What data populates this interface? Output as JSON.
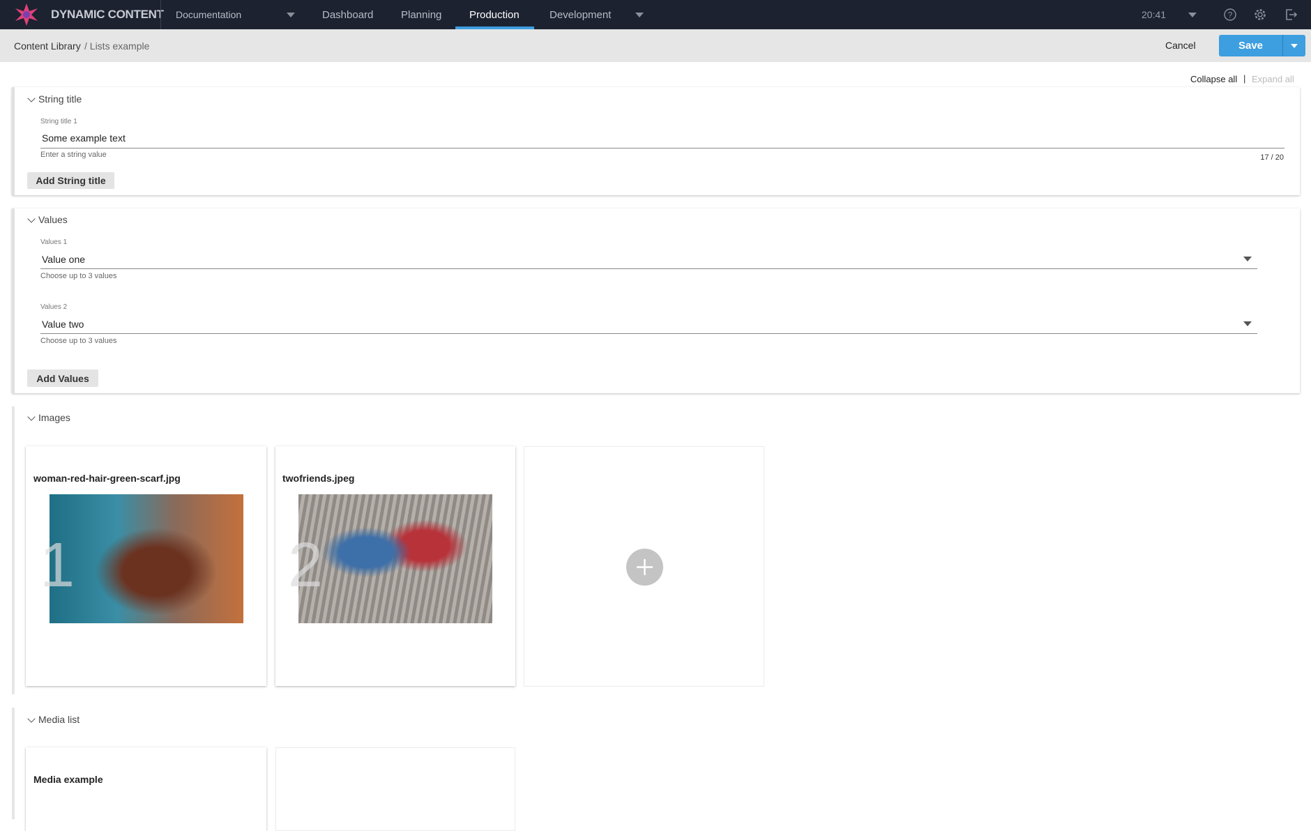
{
  "nav": {
    "brand": "DYNAMIC CONTENT",
    "hub": "Documentation",
    "tabs": [
      "Dashboard",
      "Planning",
      "Production",
      "Development"
    ],
    "active_tab": "Production",
    "time": "20:41",
    "accent": "#3d9ee0"
  },
  "breadcrumb": {
    "root": "Content Library",
    "current": "/ Lists example"
  },
  "actions": {
    "cancel": "Cancel",
    "save": "Save",
    "collapse_all": "Collapse all",
    "separator": "|",
    "expand_all": "Expand all"
  },
  "string_section": {
    "title": "String title",
    "field_label": "String title 1",
    "value": "Some example text",
    "helper": "Enter a string value",
    "counter": "17 / 20",
    "add_button": "Add String title"
  },
  "values_section": {
    "title": "Values",
    "fields": [
      {
        "label": "Values 1",
        "value": "Value one",
        "helper": "Choose up to 3 values"
      },
      {
        "label": "Values 2",
        "value": "Value two",
        "helper": "Choose up to 3 values"
      }
    ],
    "add_button": "Add Values"
  },
  "images_section": {
    "title": "Images",
    "items": [
      {
        "index": "1",
        "name": "woman-red-hair-green-scarf.jpg"
      },
      {
        "index": "2",
        "name": "twofriends.jpeg"
      }
    ]
  },
  "media_section": {
    "title": "Media list",
    "items": [
      {
        "name": "Media example"
      }
    ]
  }
}
